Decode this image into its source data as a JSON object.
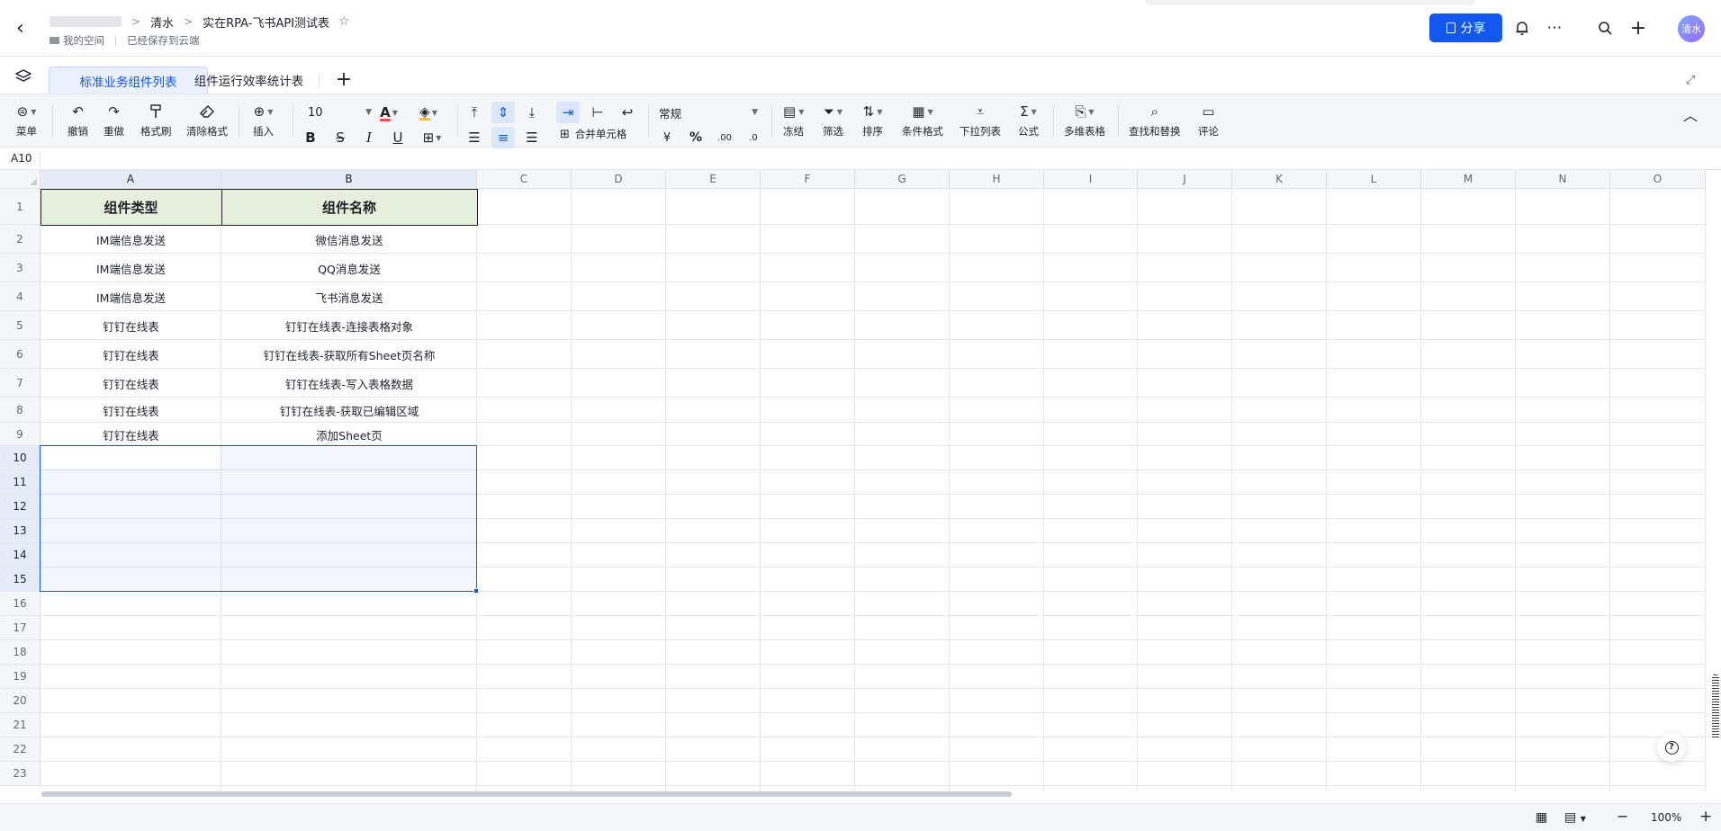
{
  "header": {
    "back_icon": "‹",
    "crumbs": [
      "清水",
      "实在RPA-飞书API测试表"
    ],
    "location": "我的空间",
    "save_status": "已经保存到云端",
    "share_label": "分享",
    "avatar_text": "清水"
  },
  "tabs": {
    "items": [
      "标准业务组件列表",
      "组件运行效率统计表"
    ],
    "add": "+"
  },
  "toolbar": {
    "menu": "菜单",
    "undo": "撤销",
    "redo": "重做",
    "format_painter": "格式刷",
    "clear_format": "清除格式",
    "insert": "插入",
    "font_size": "10",
    "number_format": "常规",
    "merge_cells": "合并单元格",
    "currency": "¥",
    "percent": "%",
    "freeze": "冻结",
    "filter": "筛选",
    "sort": "排序",
    "conditional_format": "条件格式",
    "dropdown_list": "下拉列表",
    "formula": "公式",
    "multi_table": "多维表格",
    "find_replace": "查找和替换",
    "comment": "评论"
  },
  "namebox": "A10",
  "grid": {
    "columns": [
      "A",
      "B",
      "C",
      "D",
      "E",
      "F",
      "G",
      "H",
      "I",
      "J",
      "K",
      "L",
      "M",
      "N",
      "O"
    ],
    "rows": [
      "1",
      "2",
      "3",
      "4",
      "5",
      "6",
      "7",
      "8",
      "9",
      "10",
      "11",
      "12",
      "13",
      "14",
      "15",
      "16",
      "17",
      "18",
      "19",
      "20",
      "21",
      "22",
      "23"
    ],
    "header_row": [
      "组件类型",
      "组件名称"
    ],
    "data": [
      [
        "IM端信息发送",
        "微信消息发送"
      ],
      [
        "IM端信息发送",
        "QQ消息发送"
      ],
      [
        "IM端信息发送",
        "飞书消息发送"
      ],
      [
        "钉钉在线表",
        "钉钉在线表-连接表格对象"
      ],
      [
        "钉钉在线表",
        "钉钉在线表-获取所有Sheet页名称"
      ],
      [
        "钉钉在线表",
        "钉钉在线表-写入表格数据"
      ],
      [
        "钉钉在线表",
        "钉钉在线表-获取已编辑区域"
      ],
      [
        "钉钉在线表",
        "添加Sheet页"
      ]
    ]
  },
  "statusbar": {
    "zoom": "100%",
    "zoom_out": "−",
    "zoom_in": "+"
  },
  "colors": {
    "accent": "#1456f0",
    "header_fill": "#e6eedc",
    "selection_border": "#1456f0"
  }
}
